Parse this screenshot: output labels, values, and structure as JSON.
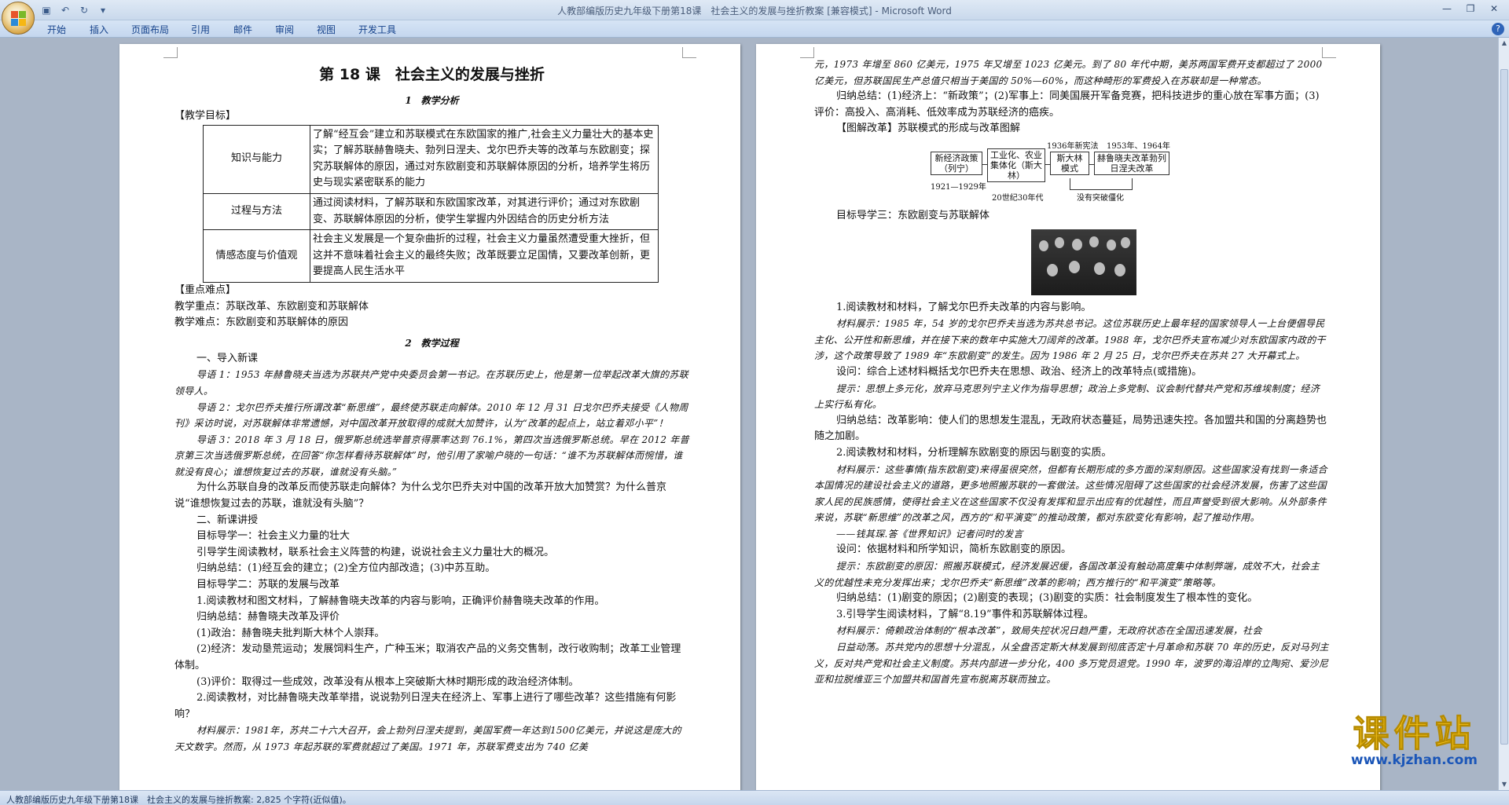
{
  "window": {
    "title": "人教部编版历史九年级下册第18课　社会主义的发展与挫折教案 [兼容模式] - Microsoft Word"
  },
  "ribbon": {
    "tabs": [
      "开始",
      "插入",
      "页面布局",
      "引用",
      "邮件",
      "审阅",
      "视图",
      "开发工具"
    ]
  },
  "left_page": {
    "lesson_title": "第 18 课　社会主义的发展与挫折",
    "sec1": "1　教学分析",
    "goals_label": "【教学目标】",
    "goals": [
      {
        "k": "知识与能力",
        "v": "了解“经互会”建立和苏联模式在东欧国家的推广,社会主义力量壮大的基本史实；了解苏联赫鲁晓夫、勃列日涅夫、戈尔巴乔夫等的改革与东欧剧变；探究苏联解体的原因，通过对东欧剧变和苏联解体原因的分析，培养学生将历史与现实紧密联系的能力"
      },
      {
        "k": "过程与方法",
        "v": "通过阅读材料，了解苏联和东欧国家改革，对其进行评价；通过对东欧剧变、苏联解体原因的分析，使学生掌握内外因结合的历史分析方法"
      },
      {
        "k": "情感态度与价值观",
        "v": "社会主义发展是一个复杂曲折的过程，社会主义力量虽然遭受重大挫折，但这并不意味着社会主义的最终失败；改革既要立足国情，又要改革创新，更要提高人民生活水平"
      }
    ],
    "key_label": "【重点难点】",
    "key_point": "教学重点：苏联改革、东欧剧变和苏联解体",
    "difficult_point": "教学难点：东欧剧变和苏联解体的原因",
    "sec2": "2　教学过程",
    "lines": [
      {
        "c": "ind2",
        "t": "一、导入新课"
      },
      {
        "c": "ind small",
        "t": "导语 1：1953 年赫鲁晓夫当选为苏联共产党中央委员会第一书记。在苏联历史上，他是第一位举起改革大旗的苏联领导人。"
      },
      {
        "c": "ind small",
        "t": "导语 2：戈尔巴乔夫推行所谓改革“新思维”，最终使苏联走向解体。2010 年 12 月 31 日戈尔巴乔夫接受《人物周刊》采访时说，对苏联解体非常遗憾，对中国改革开放取得的成就大加赞许，认为“改革的起点上，站立着邓小平”！"
      },
      {
        "c": "ind small",
        "t": "导语 3：2018 年 3 月 18 日，俄罗斯总统选举普京得票率达到 76.1%，第四次当选俄罗斯总统。早在 2012 年普京第三次当选俄罗斯总统，在回答“你怎样看待苏联解体”时，他引用了家喻户晓的一句话：“谁不为苏联解体而惋惜，谁就没有良心；谁想恢复过去的苏联，谁就没有头脑。”"
      },
      {
        "c": "ind",
        "t": "为什么苏联自身的改革反而使苏联走向解体？为什么戈尔巴乔夫对中国的改革开放大加赞赏？为什么普京说“谁想恢复过去的苏联，谁就没有头脑”？"
      },
      {
        "c": "ind2",
        "t": "二、新课讲授"
      },
      {
        "c": "ind2",
        "t": "目标导学一：社会主义力量的壮大"
      },
      {
        "c": "ind2",
        "t": "引导学生阅读教材，联系社会主义阵营的构建，说说社会主义力量壮大的概况。"
      },
      {
        "c": "ind2",
        "t": "归纳总结：(1)经互会的建立；(2)全方位内部改造；(3)中苏互助。"
      },
      {
        "c": "ind2",
        "t": "目标导学二：苏联的发展与改革"
      },
      {
        "c": "ind2",
        "t": "1.阅读教材和图文材料，了解赫鲁晓夫改革的内容与影响，正确评价赫鲁晓夫改革的作用。"
      },
      {
        "c": "ind2",
        "t": "归纳总结：赫鲁晓夫改革及评价"
      },
      {
        "c": "ind2",
        "t": "(1)政治：赫鲁晓夫批判斯大林个人崇拜。"
      },
      {
        "c": "ind",
        "t": "(2)经济：发动垦荒运动；发展饲料生产，广种玉米；取消农产品的义务交售制，改行收购制；改革工业管理体制。"
      },
      {
        "c": "ind2",
        "t": "(3)评价：取得过一些成效，改革没有从根本上突破斯大林时期形成的政治经济体制。"
      },
      {
        "c": "ind",
        "t": "2.阅读教材，对比赫鲁晓夫改革举措，说说勃列日涅夫在经济上、军事上进行了哪些改革？这些措施有何影响？"
      },
      {
        "c": "ind small",
        "t": "材料展示：1981年，苏共二十六大召开，会上勃列日涅夫提到，美国军费一年达到1500亿美元，并说这是庞大的天文数字。然而，从 1973 年起苏联的军费就超过了美国。1971 年，苏联军费支出为 740 亿美"
      }
    ]
  },
  "right_page": {
    "lines_top": [
      {
        "c": "small",
        "t": "元，1973 年增至 860 亿美元，1975 年又增至 1023 亿美元。到了 80 年代中期，美苏两国军费开支都超过了 2000 亿美元，但苏联国民生产总值只相当于美国的 50%—60%，而这种畸形的军费投入在苏联却是一种常态。"
      },
      {
        "c": "ind",
        "t": "归纳总结：(1)经济上：“新政策”；(2)军事上：同美国展开军备竞赛，把科技进步的重心放在军事方面；(3)评价：高投入、高消耗、低效率成为苏联经济的癌疾。"
      },
      {
        "c": "ind",
        "t": "【图解改革】苏联模式的形成与改革图解"
      }
    ],
    "diagram": {
      "b1": "新经济政策（列宁）",
      "b2": "工业化、农业集体化（斯大林）",
      "b3": "斯大林模式",
      "b4": "赫鲁晓夫改革勃列日涅夫改革",
      "t1": "1921—1929年",
      "t2": "20世纪30年代",
      "t3": "1936年新宪法",
      "t4": "1953年、1964年",
      "t5": "没有突破僵化"
    },
    "target3": "目标导学三：东欧剧变与苏联解体",
    "lines_bottom": [
      {
        "c": "ind",
        "t": "1.阅读教材和材料，了解戈尔巴乔夫改革的内容与影响。"
      },
      {
        "c": "ind small",
        "t": "材料展示：1985 年，54 岁的戈尔巴乔夫当选为苏共总书记。这位苏联历史上最年轻的国家领导人一上台便倡导民主化、公开性和新思维，并在接下来的数年中实施大刀阔斧的改革。1988 年，戈尔巴乔夫宣布减少对东欧国家内政的干涉，这个政策导致了 1989 年“东欧剧变”的发生。因为 1986 年 2 月 25 日，戈尔巴乔夫在苏共 27 大开幕式上。"
      },
      {
        "c": "ind",
        "t": "设问：综合上述材料概括戈尔巴乔夫在思想、政治、经济上的改革特点(或措施)。"
      },
      {
        "c": "ind small",
        "t": "提示：思想上多元化，放弃马克思列宁主义作为指导思想；政治上多党制、议会制代替共产党和苏维埃制度；经济上实行私有化。"
      },
      {
        "c": "ind",
        "t": "归纳总结：改革影响：使人们的思想发生混乱，无政府状态蔓延，局势迅速失控。各加盟共和国的分离趋势也随之加剧。"
      },
      {
        "c": "ind",
        "t": "2.阅读教材和材料，分析理解东欧剧变的原因与剧变的实质。"
      },
      {
        "c": "ind small",
        "t": "材料展示：这些事情(指东欧剧变)来得虽很突然，但都有长期形成的多方面的深刻原因。这些国家没有找到一条适合本国情况的建设社会主义的道路，更多地照搬苏联的一套做法。这些情况阻碍了这些国家的社会经济发展，伤害了这些国家人民的民族感情，使得社会主义在这些国家不仅没有发挥和显示出应有的优越性，而且声誉受到很大影响。从外部条件来说，苏联“新思维”的改革之风，西方的“和平演变”的推动政策，都对东欧变化有影响，起了推动作用。"
      },
      {
        "c": "ind small",
        "t": "——钱其琛.答《世界知识》记者问时的发言"
      },
      {
        "c": "ind",
        "t": "设问：依据材料和所学知识，简析东欧剧变的原因。"
      },
      {
        "c": "ind small",
        "t": "提示：东欧剧变的原因：照搬苏联模式，经济发展迟缓，各国改革没有触动高度集中体制弊端，成效不大，社会主义的优越性未充分发挥出来；戈尔巴乔夫“新思维”改革的影响；西方推行的“和平演变”策略等。"
      },
      {
        "c": "ind",
        "t": "归纳总结：(1)剧变的原因；(2)剧变的表现；(3)剧变的实质：社会制度发生了根本性的变化。"
      },
      {
        "c": "ind",
        "t": "3.引导学生阅读材料，了解“8.19”事件和苏联解体过程。"
      },
      {
        "c": "ind small",
        "t": "材料展示：倚赖政治体制的“根本改革”，致局失控状况日趋严重，无政府状态在全国迅速发展，社会"
      },
      {
        "c": "ind small",
        "t": "日益动荡。苏共党内的思想十分混乱，从全盘否定斯大林发展到彻底否定十月革命和苏联 70 年的历史，反对马列主义，反对共产党和社会主义制度。苏共内部进一步分化，400 多万党员退党。1990 年，波罗的海沿岸的立陶宛、爱沙尼亚和拉脱维亚三个加盟共和国首先宣布脱离苏联而独立。"
      }
    ]
  },
  "watermark": {
    "line1": "课件站",
    "line2": "www.kjzhan.com"
  },
  "status_bar": {
    "text": "人教部编版历史九年级下册第18课　社会主义的发展与挫折教案: 2,825 个字符(近似值)。"
  }
}
